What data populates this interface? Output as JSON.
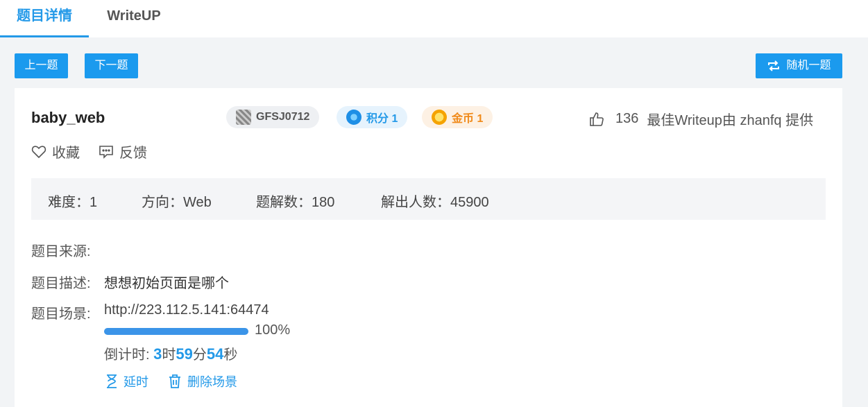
{
  "tabs": [
    {
      "label": "题目详情",
      "active": true
    },
    {
      "label": "WriteUP",
      "active": false
    }
  ],
  "nav": {
    "prev_label": "上一题",
    "next_label": "下一题",
    "random_label": "随机一题"
  },
  "challenge": {
    "title": "baby_web",
    "id_badge": "GFSJ0712",
    "score_badge": "积分 1",
    "coin_badge": "金币 1",
    "likes": "136",
    "writeup_credit": "最佳Writeup由 zhanfq 提供",
    "favorite_label": "收藏",
    "feedback_label": "反馈"
  },
  "stats": {
    "difficulty": "难度：1",
    "direction": "方向：Web",
    "solutions": "题解数：180",
    "solvers": "解出人数：45900"
  },
  "details": {
    "source_label": "题目来源:",
    "source_value": "",
    "desc_label": "题目描述:",
    "desc_value": "想想初始页面是哪个",
    "scene_label": "题目场景:",
    "scene_url": "http://223.112.5.141:64474",
    "progress_percent": 100,
    "progress_text": "100%",
    "countdown_prefix": "倒计时: ",
    "hours": "3",
    "hours_unit": "时",
    "minutes": "59",
    "minutes_unit": "分",
    "seconds": "54",
    "seconds_unit": "秒",
    "extend_label": "延时",
    "delete_label": "删除场景"
  },
  "colors": {
    "accent": "#2399e8",
    "button": "#1b9aee",
    "page_bg": "#f2f4f6"
  }
}
